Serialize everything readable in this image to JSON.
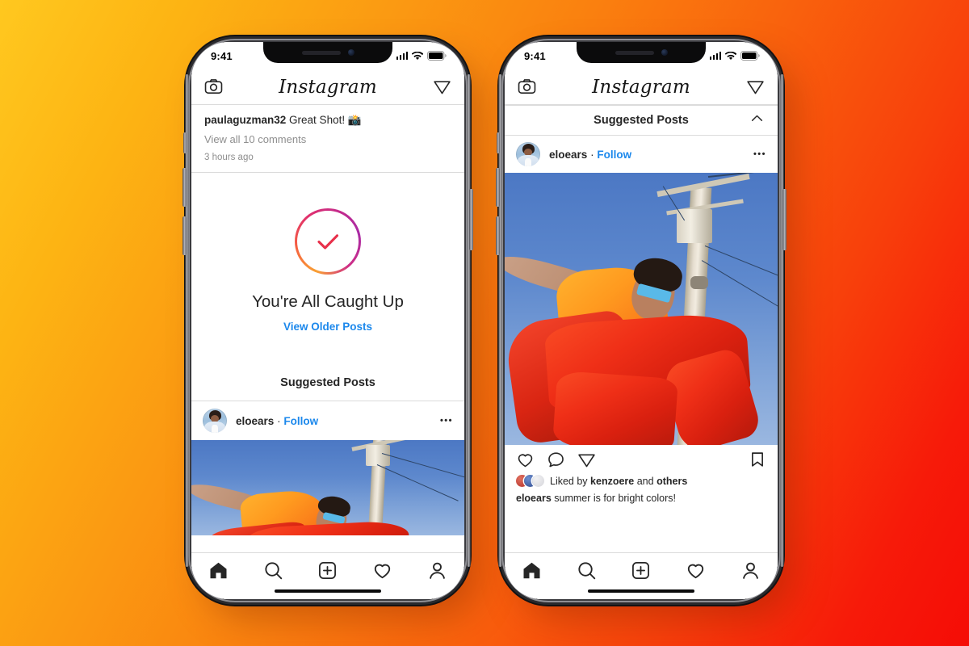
{
  "background": {
    "gradient_from": "#FFC81F",
    "gradient_mid": "#FA810F",
    "gradient_to": "#F50C06",
    "description": "diagonal yellow-orange-red gradient"
  },
  "phones": [
    {
      "id": "left",
      "status_bar": {
        "time": "9:41",
        "signal": "signal-bars",
        "wifi": "wifi-icon",
        "battery": "battery-icon"
      },
      "header": {
        "camera_label": "camera-icon",
        "logo": "Instagram",
        "direct_label": "paper-plane-icon"
      },
      "previous_post": {
        "username": "paulaguzman32",
        "comment": "Great Shot!",
        "emoji": "📸",
        "view_comments": "View all 10 comments",
        "timestamp": "3 hours ago"
      },
      "caught_up": {
        "icon": "check-circle-icon",
        "title": "You're All Caught Up",
        "link": "View Older Posts",
        "link_color": "#1c88ec"
      },
      "suggested": {
        "title": "Suggested Posts",
        "collapsible": false
      },
      "post": {
        "username": "eloears",
        "separator": "·",
        "follow_label": "Follow",
        "more_label": "•••",
        "photo_alt": "person in orange shirt and red pants beside a utility pole against blue sky"
      },
      "tabbar": [
        "home-icon",
        "search-icon",
        "add-post-icon",
        "activity-heart-icon",
        "profile-icon"
      ]
    },
    {
      "id": "right",
      "status_bar": {
        "time": "9:41",
        "signal": "signal-bars",
        "wifi": "wifi-icon",
        "battery": "battery-icon"
      },
      "header": {
        "camera_label": "camera-icon",
        "logo": "Instagram",
        "direct_label": "paper-plane-icon"
      },
      "suggested": {
        "title": "Suggested Posts",
        "collapsible": true,
        "chevron": "chevron-up-icon"
      },
      "post": {
        "username": "eloears",
        "separator": "·",
        "follow_label": "Follow",
        "more_label": "•••",
        "photo_alt": "person in orange shirt and red pants beside a utility pole against blue sky"
      },
      "actions": {
        "like": "heart-icon",
        "comment": "comment-bubble-icon",
        "share": "paper-plane-icon",
        "save": "bookmark-icon"
      },
      "likes": {
        "prefix": "Liked by",
        "username": "kenzoere",
        "middle": "and",
        "suffix": "others"
      },
      "caption": {
        "username": "eloears",
        "text": "summer is for bright colors!"
      },
      "tabbar": [
        "home-icon",
        "search-icon",
        "add-post-icon",
        "activity-heart-icon",
        "profile-icon"
      ]
    }
  ]
}
